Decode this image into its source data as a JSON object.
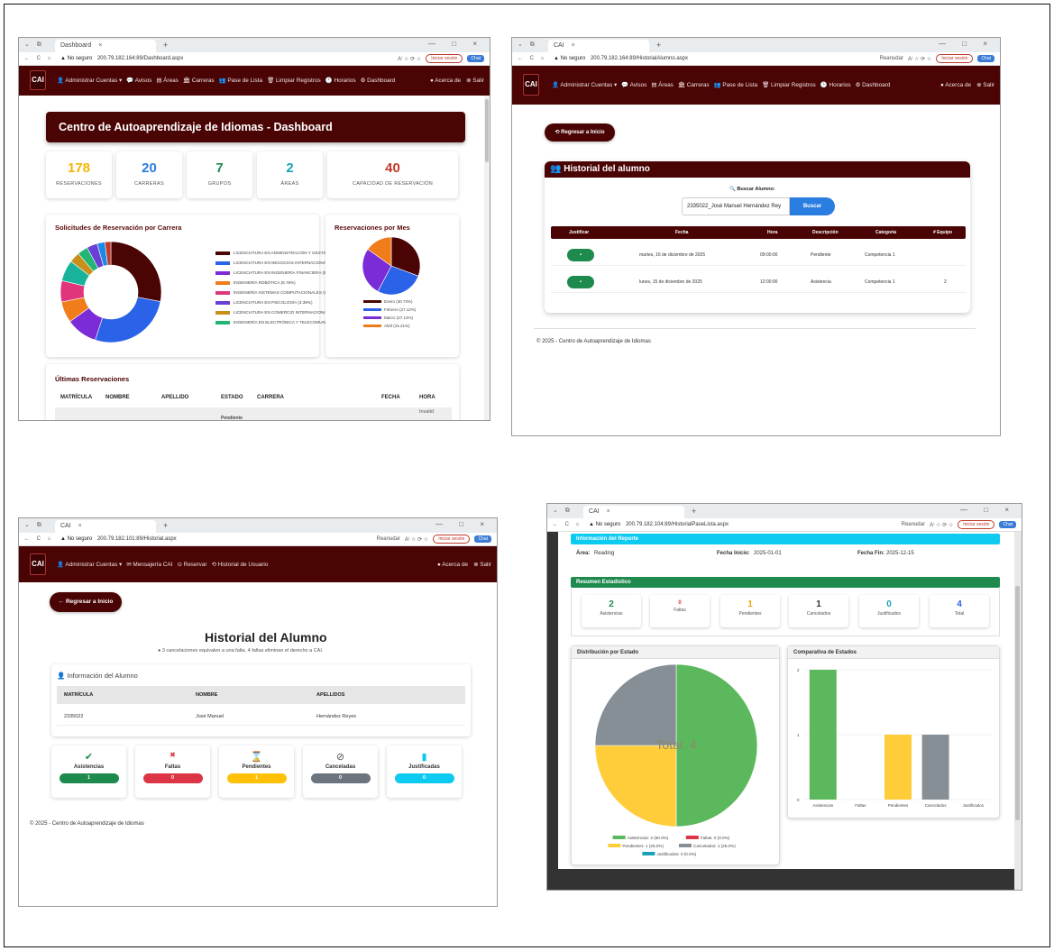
{
  "colors": {
    "primary": "#4a0404",
    "success": "#1e8a4e",
    "danger": "#dc3545",
    "warning": "#ffc107",
    "secondary": "#6c757d",
    "info": "#0dcaf0"
  },
  "browser": {
    "sq": "⌄ ⧉",
    "close": "×",
    "plus": "+",
    "controls": "— □ ×",
    "nav": "← C ⌂",
    "warn": "▲ No seguro",
    "tab_dashboard": "Dashboard",
    "tab_cai": "CAI",
    "url1": "200.79.182.164:89/Dashboard.aspx",
    "url2": "200.79.182.164:89/HistorialAlumno.aspx",
    "url3": "200.79.182.101:89/Historial.aspx",
    "url4": "200.79.182.104:89/HistorialPaseLista.aspx",
    "reset": "Reanudar",
    "signin": "Iniciar sesión",
    "chat": "Chat",
    "icons": "A⁾ ☆ ⟳ ☆"
  },
  "nav": {
    "logo": "CAI",
    "admin": "👤 Administrar Cuentas ▾",
    "avisos": "💬 Avisos",
    "areas": "▤ Áreas",
    "carreras": "🏛 Carreras",
    "pase": "👥 Pase de Lista",
    "limpiar": "🗑 Limpiar Registros",
    "horarios": "🕒 Horarios",
    "dashboard": "⚙ Dashboard",
    "acerca": "● Acerca de",
    "salir": "⊗ Salir",
    "mensajeria": "✉ Mensajería CAI",
    "reservar": "⊙ Reservar",
    "historial": "⟲ Historial de Usuario"
  },
  "dashboard": {
    "title": "Centro de Autoaprendizaje de Idiomas - Dashboard",
    "stats": [
      {
        "value": "178",
        "label": "RESERVACIONES",
        "color": "#f4b400"
      },
      {
        "value": "20",
        "label": "CARRERAS",
        "color": "#2a7de1"
      },
      {
        "value": "7",
        "label": "GRUPOS",
        "color": "#1e8a4e"
      },
      {
        "value": "2",
        "label": "ÁREAS",
        "color": "#17a2b8"
      },
      {
        "value": "40",
        "label": "CAPACIDAD DE RESERVACIÓN",
        "color": "#c0392b"
      }
    ],
    "donut_title": "Solicitudes de Reservación por Carrera",
    "legend": [
      {
        "label": "LICENCIATURA EN ADMINISTRACIÓN Y GESTIÓ",
        "color": "#4a0404"
      },
      {
        "label": "LICENCIATURA EN NEGOCIOS INTERNACIONAL",
        "color": "#2a62e8"
      },
      {
        "label": "LICENCIATURA EN INGENIERÍA FINANCIERA (9.",
        "color": "#7b2cd6"
      },
      {
        "label": "INGENIERÍA ROBÓTICA (6.78%)",
        "color": "#f07c1a"
      },
      {
        "label": "INGENIERÍA SISTEMAS COMPUTACIONALES (6.",
        "color": "#e0357a"
      },
      {
        "label": "LICENCIATURA EN PSICOLOGÍA (3.39%)",
        "color": "#6a3fd6"
      },
      {
        "label": "LICENCIATURA EN COMERCIO INTERNACIONAL",
        "color": "#c8901a"
      },
      {
        "label": "INGENIERÍA EN ELECTRÓNICA Y TELECOMUNI",
        "color": "#22b573"
      }
    ],
    "pie_title": "Reservaciones por Mes",
    "pie_legend": [
      {
        "label": "Enero (30.73%)",
        "color": "#4a0404"
      },
      {
        "label": "Febrero (27.12%)",
        "color": "#2a62e8"
      },
      {
        "label": "Marzo (27.12%)",
        "color": "#7b2cd6"
      },
      {
        "label": "Abril (15.21%)",
        "color": "#f07c1a"
      }
    ],
    "table_title": "Últimas Reservaciones",
    "table_headers": [
      "MATRÍCULA",
      "NOMBRE",
      "APELLIDO",
      "ESTADO",
      "CARRERA",
      "FECHA",
      "HORA"
    ],
    "row_invalid": "Invalid",
    "row_estado": "Pendiente"
  },
  "historial1": {
    "back": "⟲ Regresar a Inicio",
    "title": "👥 Historial del alumno",
    "search_label": "🔍 Buscar Alumno:",
    "search_value": "2335022_José Manuel Hernández Rey",
    "search_button": "Buscar",
    "headers": [
      "Justificar",
      "Fecha",
      "Hora",
      "Descripción",
      "Categoría",
      "# Equipo"
    ],
    "rows": [
      {
        "fecha": "martes, 16 de diciembre de 2025",
        "hora": "09:00:00",
        "desc": "Pendiente",
        "cat": "Competencia 1",
        "equipo": ""
      },
      {
        "fecha": "lunes, 15 de diciembre de 2025",
        "hora": "12:00:00",
        "desc": "Asistencia",
        "cat": "Competencia 1",
        "equipo": "2"
      }
    ],
    "footer": "© 2025 - Centro de Autoaprendizaje de Idiomas"
  },
  "historial2": {
    "back": "← Regresar a Inicio",
    "title": "Historial del Alumno",
    "note": "● 3 cancelaciones equivalen a una falta. 4 faltas eliminan el derecho a CAI.",
    "info_title": "👤 Información del Alumno",
    "headers": [
      "MATRÍCULA",
      "NOMBRE",
      "APELLIDOS"
    ],
    "values": [
      "2335022",
      "José Manuel",
      "Hernández Reyes"
    ],
    "cards": [
      {
        "label": "Asistencias",
        "value": "1",
        "color": "#1e8a4e",
        "icon": "✔",
        "icolor": "#1e8a4e"
      },
      {
        "label": "Faltas",
        "value": "0",
        "color": "#dc3545",
        "icon": "✖",
        "icolor": "#dc3545"
      },
      {
        "label": "Pendientes",
        "value": "1",
        "color": "#ffc107",
        "icon": "⌛",
        "icolor": "#f0ad00"
      },
      {
        "label": "Canceladas",
        "value": "0",
        "color": "#6c757d",
        "icon": "⃠",
        "icolor": "#555"
      },
      {
        "label": "Justificadas",
        "value": "0",
        "color": "#0dcaf0",
        "icon": "▮",
        "icolor": "#0dcaf0"
      }
    ],
    "footer": "© 2025 - Centro de Autoaprendizaje de Idiomas"
  },
  "reporte": {
    "info_title": "Información del Reporte",
    "area_label": "Área:",
    "area_value": "Reading",
    "inicio_label": "Fecha Inicio:",
    "inicio_value": "2025-01-01",
    "fin_label": "Fecha Fin:",
    "fin_value": "2025-12-15",
    "resumen_title": "Resumen Estadístico",
    "stats": [
      {
        "value": "2",
        "label": "Asistencias",
        "color": "#1e8a4e"
      },
      {
        "value": "0",
        "label": "Faltas",
        "color": "#dc3545"
      },
      {
        "value": "1",
        "label": "Pendientes",
        "color": "#f0a500"
      },
      {
        "value": "1",
        "label": "Cancelados",
        "color": "#333"
      },
      {
        "value": "0",
        "label": "Justificados",
        "color": "#17a2b8"
      },
      {
        "value": "4",
        "label": "Total",
        "color": "#2a62e8"
      }
    ],
    "pie_title": "Distribución por Estado",
    "pie_total": "Total: 4",
    "bar_title": "Comparativa de Estados"
  },
  "chart_data": [
    {
      "type": "pie",
      "title": "Solicitudes de Reservación por Carrera",
      "categories": [
        "LICENCIATURA EN ADMINISTRACIÓN Y GESTIÓ",
        "LICENCIATURA EN NEGOCIOS INTERNACIONAL",
        "LICENCIATURA EN INGENIERÍA FINANCIERA (9.",
        "INGENIERÍA ROBÓTICA (6.78%)",
        "INGENIERÍA SISTEMAS COMPUTACIONALES (6.",
        "LICENCIATURA EN PSICOLOGÍA (3.39%)",
        "LICENCIATURA EN COMERCIO INTERNACIONAL",
        "INGENIERÍA EN ELECTRÓNICA Y TELECOMUNI",
        "",
        "",
        ""
      ],
      "values": [
        28,
        27,
        10,
        6.78,
        6.78,
        6.78,
        3.39,
        3.39,
        3.39,
        2.5,
        1.9
      ],
      "colors": [
        "#4a0404",
        "#2a62e8",
        "#7b2cd6",
        "#f07c1a",
        "#e0357a",
        "#19b39c",
        "#c8901a",
        "#22b573",
        "#6a3fd6",
        "#1e88e5",
        "#c0392b"
      ]
    },
    {
      "type": "pie",
      "title": "Reservaciones por Mes",
      "categories": [
        "Enero (30.73%)",
        "Febrero (27.12%)",
        "Marzo (27.12%)",
        "Abril (15.21%)"
      ],
      "values": [
        30.73,
        27.12,
        27.12,
        15.21
      ],
      "colors": [
        "#4a0404",
        "#2a62e8",
        "#7b2cd6",
        "#f07c1a"
      ]
    },
    {
      "type": "pie",
      "title": "Distribución por Estado",
      "categories": [
        "Asistencias: 2 (50.0%)",
        "Faltas: 0 (0.0%)",
        "Pendientes: 1 (25.0%)",
        "Cancelados: 1 (25.0%)",
        "Justificados: 0 (0.0%)"
      ],
      "values": [
        2,
        0,
        1,
        1,
        0
      ],
      "colors": [
        "#5cb85c",
        "#dc3545",
        "#ffcd39",
        "#868e96",
        "#17a2b8"
      ]
    },
    {
      "type": "bar",
      "title": "Comparativa de Estados",
      "categories": [
        "Asistencias",
        "Faltas",
        "Pendientes",
        "Cancelados",
        "Justificados"
      ],
      "values": [
        2,
        0,
        1,
        1,
        0
      ],
      "colors": [
        "#5cb85c",
        "#dc3545",
        "#ffcd39",
        "#868e96",
        "#17a2b8"
      ],
      "ylim": [
        0,
        2
      ],
      "yticks": [
        "2",
        "1",
        "0"
      ]
    }
  ]
}
